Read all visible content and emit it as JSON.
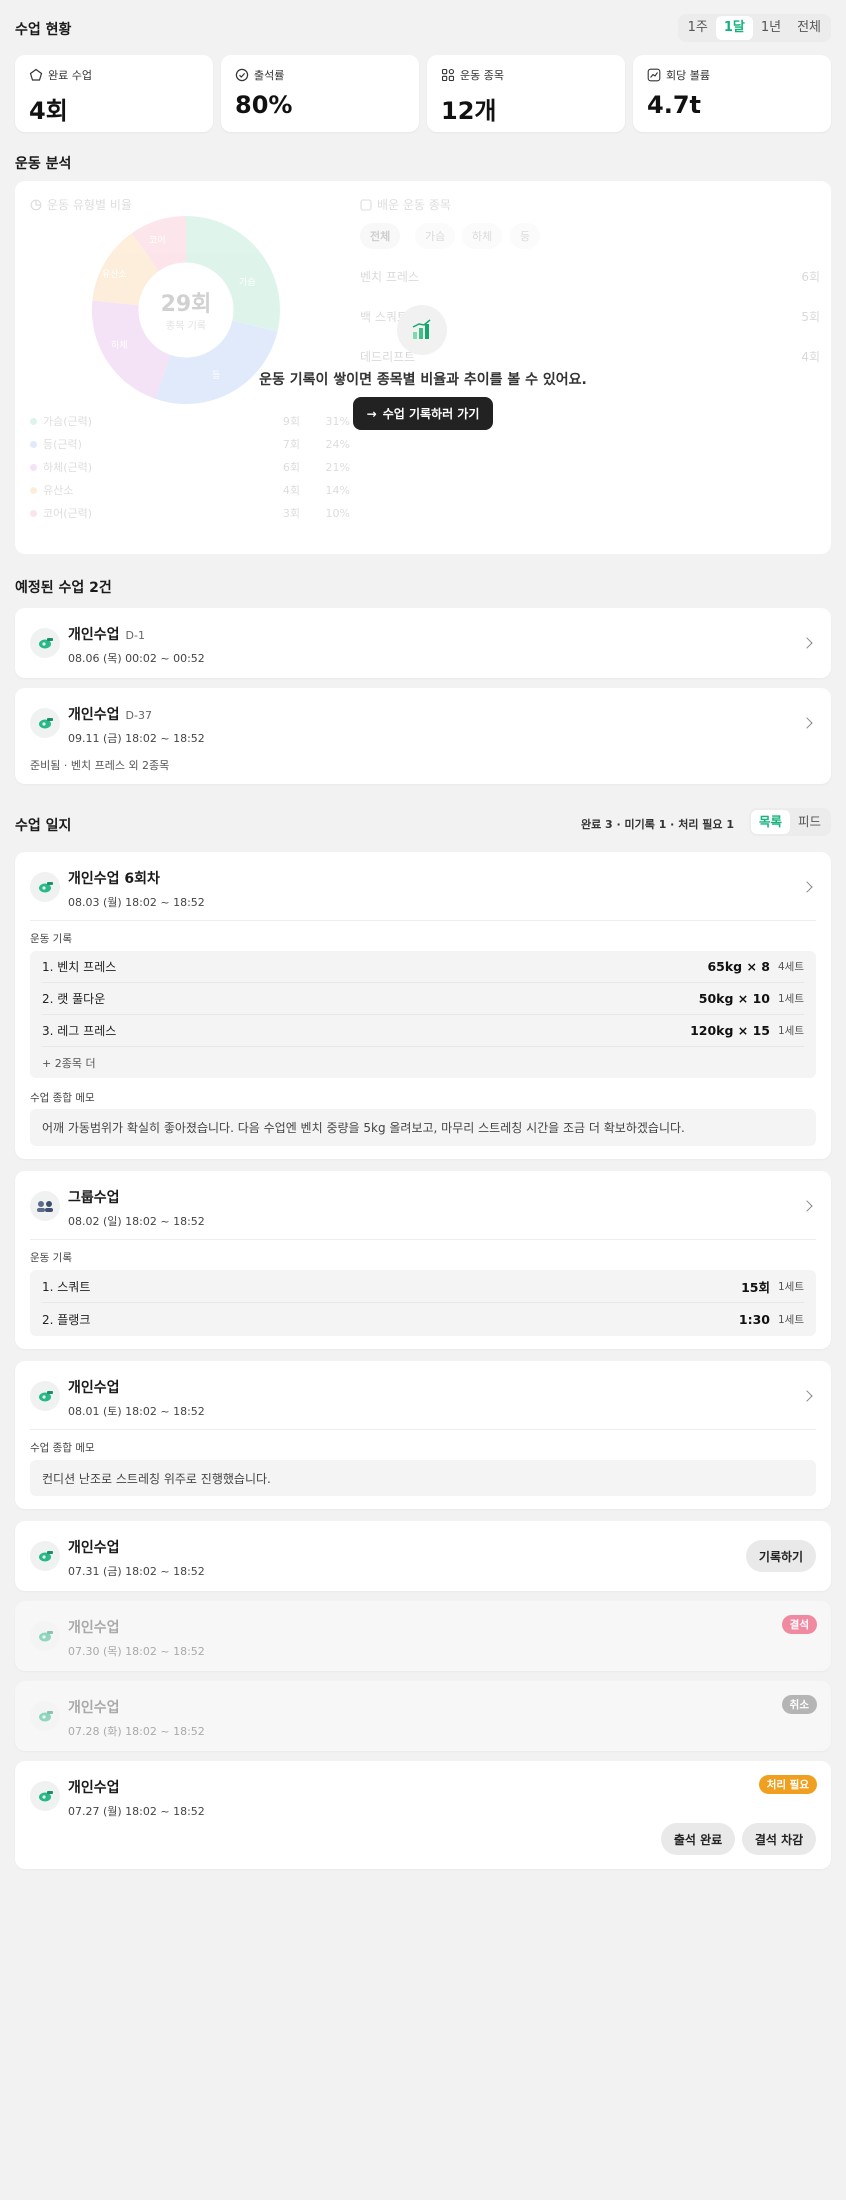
{
  "overview": {
    "title": "수업 현황",
    "periods": [
      "1주",
      "1달",
      "1년",
      "전체"
    ],
    "active_period": "1달",
    "stats": [
      {
        "label": "완료 수업",
        "value": "4회",
        "icon": "pentagon-icon"
      },
      {
        "label": "출석률",
        "value": "80%",
        "icon": "check-circle-icon"
      },
      {
        "label": "운동 종목",
        "value": "12개",
        "icon": "grid-icon"
      },
      {
        "label": "회당 볼륨",
        "value": "4.7t",
        "icon": "trend-icon"
      }
    ]
  },
  "analysis": {
    "title": "운동 분석",
    "ratio_title": "운동 유형별 비율",
    "donut_total": "29회",
    "donut_caption": "종목 기록",
    "legend": [
      {
        "name": "가슴(근력)",
        "count": "9회",
        "pct": "31%",
        "color": "#bfe7d4"
      },
      {
        "name": "등(근력)",
        "count": "7회",
        "pct": "24%",
        "color": "#b9cff7"
      },
      {
        "name": "하체(근력)",
        "count": "6회",
        "pct": "21%",
        "color": "#e2bde8"
      },
      {
        "name": "유산소",
        "count": "4회",
        "pct": "14%",
        "color": "#f6d6a9"
      },
      {
        "name": "코어(근력)",
        "count": "3회",
        "pct": "10%",
        "color": "#f5b8c6"
      }
    ],
    "slice_labels": [
      "가슴",
      "등",
      "하체",
      "유산소",
      "코어"
    ],
    "top_title": "배운 운동 종목",
    "top_tabs": [
      "전체",
      "가슴",
      "하체",
      "등"
    ],
    "top_rows": [
      {
        "name": "벤치 프레스",
        "count": "6회"
      },
      {
        "name": "백 스쿼트",
        "count": "5회"
      },
      {
        "name": "데드리프트",
        "count": "4회"
      }
    ],
    "empty_message": "운동 기록이 쌓이면 종목별 비율과 추이를 볼 수 있어요.",
    "cta_label": "수업 기록하러 가기"
  },
  "upcoming": {
    "title": "예정된 수업 2건",
    "items": [
      {
        "title": "개인수업",
        "dday": "D-1",
        "date": "08.06 (목)  00:02 ~ 00:52",
        "note": ""
      },
      {
        "title": "개인수업",
        "dday": "D-37",
        "date": "09.11 (금)  18:02 ~ 18:52",
        "note": "준비됨 · 벤치 프레스 외 2종목"
      }
    ]
  },
  "log": {
    "title": "수업 일지",
    "summary": "완료 3 · 미기록 1 · 처리 필요 1",
    "views": [
      "목록",
      "피드"
    ],
    "active_view": "목록",
    "exercise_label": "운동 기록",
    "memo_label": "수업 종합 메모",
    "entries": [
      {
        "title": "개인수업 6회차",
        "date": "08.03 (월)  18:02 ~ 18:52",
        "exercises": [
          {
            "name": "1.  벤치 프레스",
            "weight": "65kg × 8",
            "sets": "4세트"
          },
          {
            "name": "2.  랫 풀다운",
            "weight": "50kg × 10",
            "sets": "1세트"
          },
          {
            "name": "3.  레그 프레스",
            "weight": "120kg × 15",
            "sets": "1세트"
          }
        ],
        "more": "+ 2종목 더",
        "memo": "어깨 가동범위가 확실히 좋아졌습니다. 다음 수업엔 벤치 중량을 5kg 올려보고, 마무리 스트레칭 시간을 조금 더 확보하겠습니다."
      },
      {
        "title": "그룹수업",
        "date": "08.02 (일)  18:02 ~ 18:52",
        "exercises": [
          {
            "name": "1.  스쿼트",
            "weight": "15회",
            "sets": "1세트"
          },
          {
            "name": "2.  플랭크",
            "weight": "1:30",
            "sets": "1세트"
          }
        ]
      },
      {
        "title": "개인수업",
        "date": "08.01 (토)  18:02 ~ 18:52",
        "memo": "컨디션 난조로 스트레칭 위주로 진행했습니다."
      },
      {
        "title": "개인수업",
        "date": "07.31 (금)  18:02 ~ 18:52",
        "action": "기록하기"
      },
      {
        "title": "개인수업",
        "date": "07.30 (목)  18:02 ~ 18:52",
        "badge": "결석",
        "badge_color": "#f08aa0"
      },
      {
        "title": "개인수업",
        "date": "07.28 (화)  18:02 ~ 18:52",
        "badge": "취소",
        "badge_color": "#b5b5b5"
      },
      {
        "title": "개인수업",
        "date": "07.27 (월)  18:02 ~ 18:52",
        "badge": "처리 필요",
        "badge_color": "#f0a020",
        "actions": [
          "출석 완료",
          "결석 차감"
        ]
      }
    ]
  },
  "colors": {
    "accent": "#15b27d",
    "background": "#f2f2f2"
  }
}
